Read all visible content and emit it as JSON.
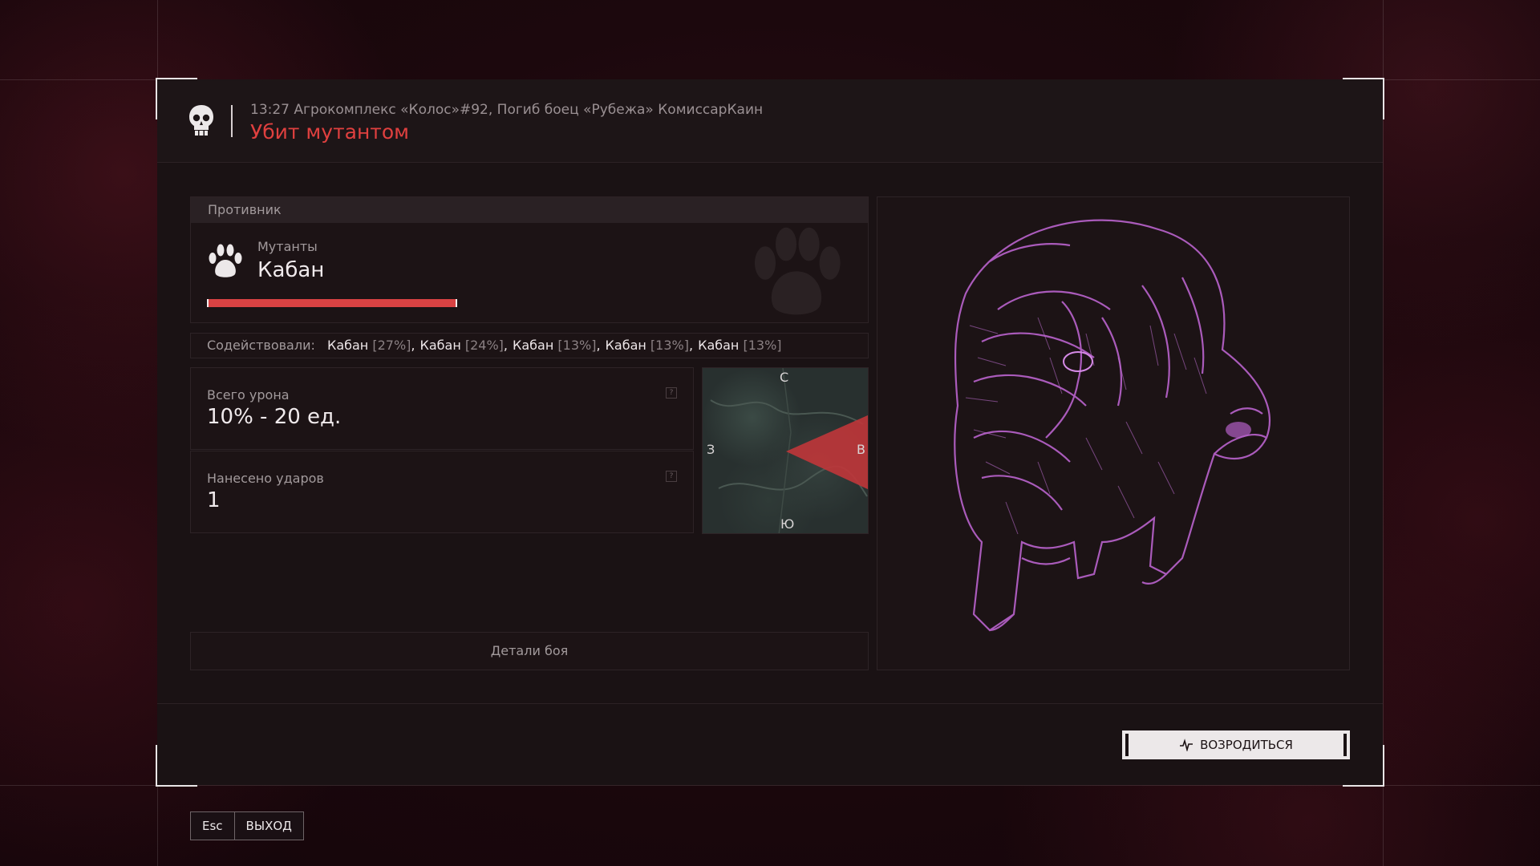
{
  "header": {
    "meta": "13:27 Агрокомплекс «Колос»#92, Погиб боец «Рубежа» КомиссарКаин",
    "title": "Убит мутантом"
  },
  "enemy": {
    "section_title": "Противник",
    "faction": "Мутанты",
    "name": "Кабан",
    "health_fraction": 1.0,
    "icon": "paw-icon"
  },
  "assists": {
    "label": "Содействовали:",
    "items": [
      {
        "name": "Кабан",
        "pct": "[27%]"
      },
      {
        "name": "Кабан",
        "pct": "[24%]"
      },
      {
        "name": "Кабан",
        "pct": "[13%]"
      },
      {
        "name": "Кабан",
        "pct": "[13%]"
      },
      {
        "name": "Кабан",
        "pct": "[13%]"
      }
    ]
  },
  "stats": {
    "damage_label": "Всего урона",
    "damage_value": "10% - 20 ед.",
    "hits_label": "Нанесено ударов",
    "hits_value": "1",
    "help_glyph": "?"
  },
  "minimap": {
    "north": "С",
    "east": "В",
    "south": "Ю",
    "west": "З"
  },
  "buttons": {
    "details": "Детали боя",
    "respawn": "ВОЗРОДИТЬСЯ",
    "esc_key": "Esc",
    "exit": "ВЫХОД"
  },
  "colors": {
    "accent_red": "#e0403f",
    "health_red": "#d94243",
    "model_tint": "#b25fc4"
  }
}
